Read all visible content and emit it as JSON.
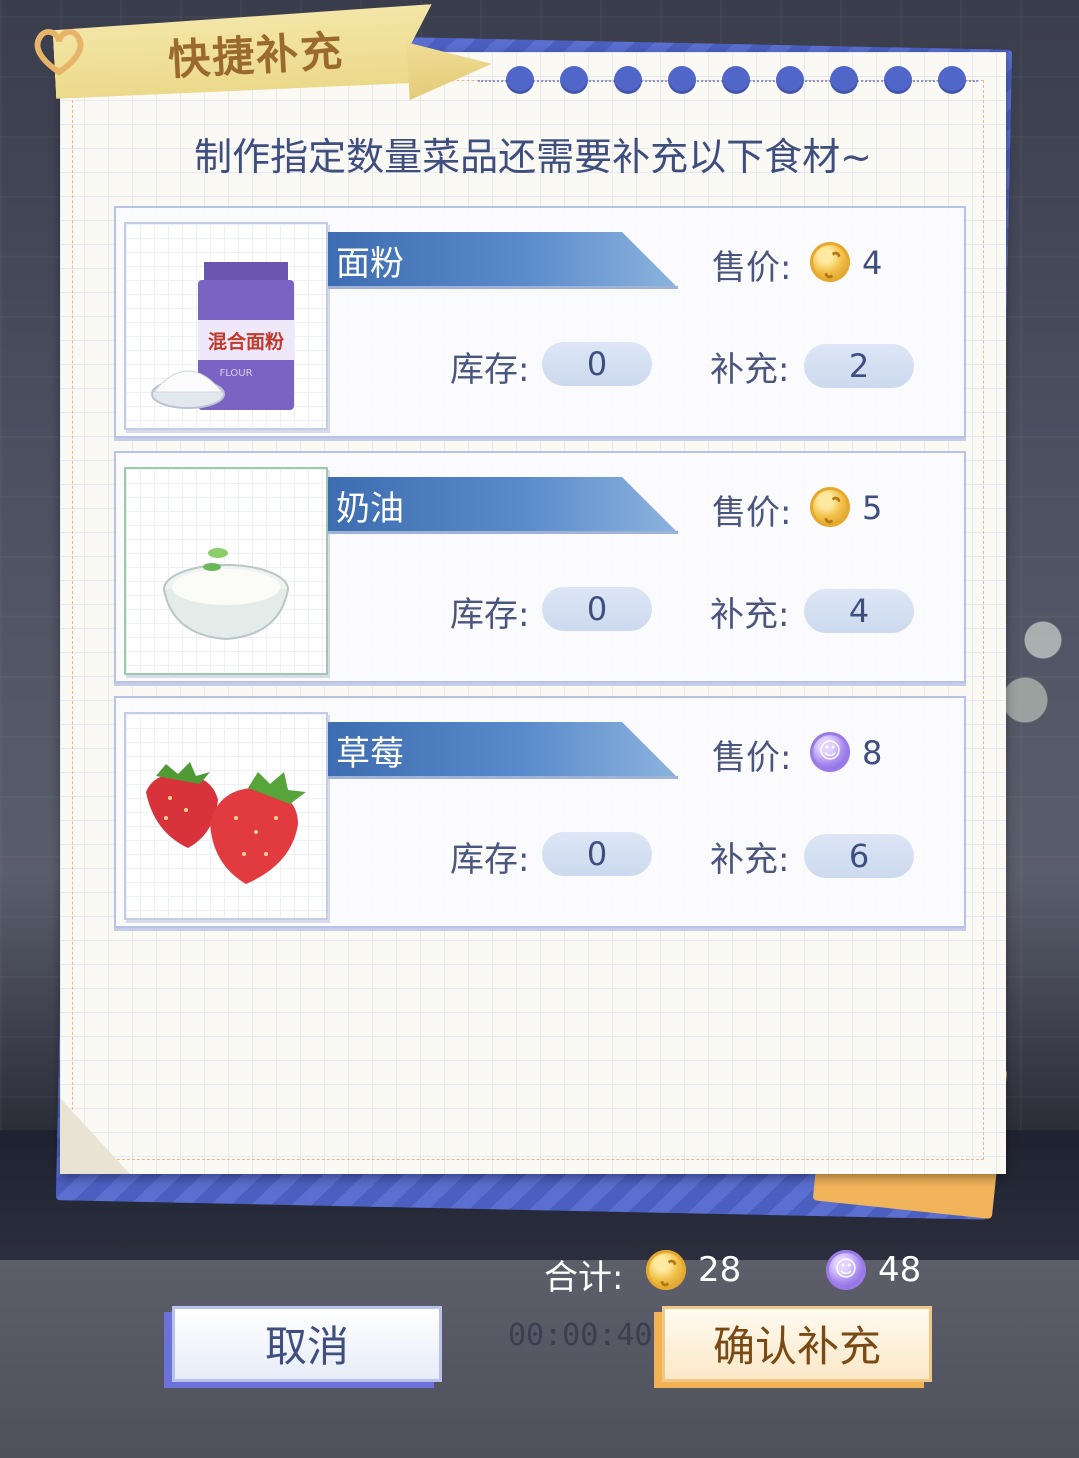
{
  "title": "快捷补充",
  "subtitle": "制作指定数量菜品还需要补充以下食材~",
  "labels": {
    "price": "售价:",
    "stock": "库存:",
    "supply": "补充:"
  },
  "items": [
    {
      "name": "面粉",
      "price": "4",
      "currency": "gold-coin",
      "stock": "0",
      "supply": "2",
      "bag_text": "混合面粉",
      "bag_sub": "FLOUR"
    },
    {
      "name": "奶油",
      "price": "5",
      "currency": "gold-coin",
      "stock": "0",
      "supply": "4"
    },
    {
      "name": "草莓",
      "price": "8",
      "currency": "purple-coin",
      "stock": "0",
      "supply": "6"
    }
  ],
  "footer": {
    "total_label": "合计:",
    "gold_total": "28",
    "purple_total": "48",
    "timer": "00:00:40",
    "cancel_label": "取消",
    "confirm_label": "确认补充"
  },
  "colors": {
    "accent_blue": "#5166c9",
    "gold": "#f2c14a",
    "purple": "#a98af0",
    "confirm_text": "#7a4a14"
  }
}
